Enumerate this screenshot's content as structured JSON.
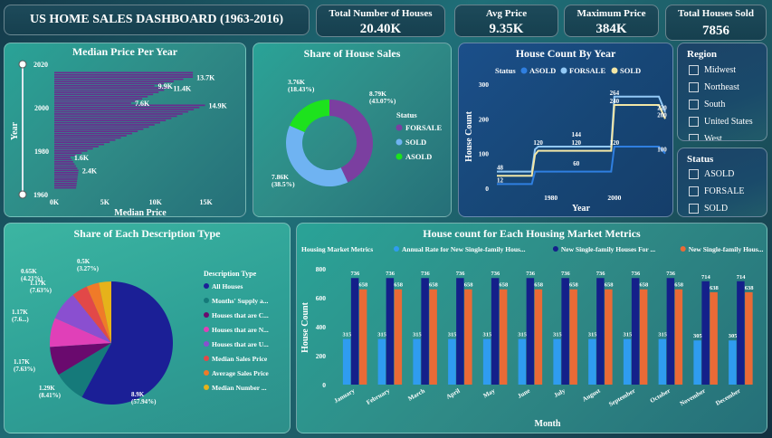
{
  "header": {
    "title": "US HOME SALES DASHBOARD (1963-2016)"
  },
  "kpis": [
    {
      "label": "Total Number of Houses",
      "value": "20.40K"
    },
    {
      "label": "Avg Price",
      "value": "9.35K"
    },
    {
      "label": "Maximum Price",
      "value": "384K"
    },
    {
      "label": "Total Houses Sold",
      "value": "7856"
    }
  ],
  "slicers": {
    "region": {
      "title": "Region",
      "options": [
        "Midwest",
        "Northeast",
        "South",
        "United States",
        "West"
      ]
    },
    "status": {
      "title": "Status",
      "options": [
        "ASOLD",
        "FORSALE",
        "SOLD"
      ]
    }
  },
  "colors": {
    "purple": "#7b3fa0",
    "lightblue": "#6fb3f2",
    "green": "#1de21d",
    "cream": "#f3e7a6",
    "sky": "#93c9f6",
    "blue": "#2f7fe0"
  },
  "chart_data": [
    {
      "id": "median",
      "type": "bar",
      "orientation": "horizontal",
      "title": "Median Price Per Year",
      "xlabel": "Median Price",
      "ylabel": "Year",
      "xticks": [
        "0K",
        "5K",
        "10K",
        "15K"
      ],
      "yticks": [
        "1960",
        "1980",
        "2000",
        "2020"
      ],
      "slider_labels": [
        "2020",
        "1960"
      ],
      "xlim": [
        0,
        17000
      ],
      "ylim": [
        1960,
        2020
      ],
      "years_range": [
        1963,
        2016
      ],
      "labeled_points": [
        {
          "year": 1971,
          "value": 2400,
          "label": "2.4K"
        },
        {
          "year": 1977,
          "value": 1600,
          "label": "1.6K"
        },
        {
          "year": 2002,
          "value": 7600,
          "label": "7.6K"
        },
        {
          "year": 2001,
          "value": 14900,
          "label": "14.9K"
        },
        {
          "year": 2009,
          "value": 11400,
          "label": "11.4K"
        },
        {
          "year": 2010,
          "value": 9900,
          "label": "9.9K"
        },
        {
          "year": 2014,
          "value": 13700,
          "label": "13.7K"
        }
      ]
    },
    {
      "id": "share_sales",
      "type": "pie",
      "title": "Share of House Sales",
      "legend_title": "Status",
      "slices": [
        {
          "name": "FORSALE",
          "value": 8790,
          "label": "8.79K (43.07%)",
          "color": "#7b3fa0"
        },
        {
          "name": "SOLD",
          "value": 7860,
          "label": "7.86K (38.5%)",
          "color": "#6fb3f2"
        },
        {
          "name": "ASOLD",
          "value": 3760,
          "label": "3.76K (18.43%)",
          "color": "#1de21d"
        }
      ]
    },
    {
      "id": "house_count",
      "type": "line",
      "title": "House Count By Year",
      "legend_title": "Status",
      "xlabel": "Year",
      "ylabel": "House Count",
      "xticks": [
        "1980",
        "2000"
      ],
      "yticks": [
        "0",
        "100",
        "200",
        "300"
      ],
      "ylim": [
        0,
        300
      ],
      "xlim": [
        1963,
        2016
      ],
      "series": [
        {
          "name": "ASOLD",
          "color": "#2f7fe0",
          "points": [
            [
              1963,
              12
            ],
            [
              1974,
              12
            ],
            [
              1975,
              48
            ],
            [
              1999,
              48
            ],
            [
              2000,
              120
            ],
            [
              2014,
              120
            ],
            [
              2016,
              100
            ]
          ]
        },
        {
          "name": "FORSALE",
          "color": "#93c9f6",
          "points": [
            [
              1963,
              48
            ],
            [
              1974,
              48
            ],
            [
              1975,
              112
            ],
            [
              1976,
              120
            ],
            [
              1999,
              120
            ],
            [
              2000,
              264
            ],
            [
              2014,
              264
            ],
            [
              2016,
              220
            ]
          ]
        },
        {
          "name": "SOLD",
          "color": "#f3e7a6",
          "points": [
            [
              1963,
              36
            ],
            [
              1974,
              36
            ],
            [
              1975,
              96
            ],
            [
              1976,
              108
            ],
            [
              1999,
              108
            ],
            [
              2000,
              240
            ],
            [
              2014,
              240
            ],
            [
              2016,
              200
            ]
          ]
        }
      ],
      "labels": [
        {
          "year": 1964,
          "value": 48,
          "text": "48"
        },
        {
          "year": 1964,
          "value": 12,
          "text": "12"
        },
        {
          "year": 1976,
          "value": 120,
          "text": "120"
        },
        {
          "year": 1988,
          "value": 144,
          "text": "144"
        },
        {
          "year": 1988,
          "value": 120,
          "text": "120"
        },
        {
          "year": 1988,
          "value": 60,
          "text": "60"
        },
        {
          "year": 2000,
          "value": 120,
          "text": "120"
        },
        {
          "year": 2000,
          "value": 264,
          "text": "264"
        },
        {
          "year": 2000,
          "value": 240,
          "text": "240"
        },
        {
          "year": 2015,
          "value": 220,
          "text": "220"
        },
        {
          "year": 2015,
          "value": 200,
          "text": "200"
        },
        {
          "year": 2015,
          "value": 100,
          "text": "100"
        }
      ]
    },
    {
      "id": "desc_share",
      "type": "pie",
      "title": "Share of Each Description Type",
      "legend_title": "Description Type",
      "slices": [
        {
          "name": "All Houses",
          "value": 57.94,
          "label": "8.9K (57.94%)",
          "color": "#1b1f96"
        },
        {
          "name": "Months' Supply a...",
          "value": 8.41,
          "label": "1.29K (8.41%)",
          "color": "#157a7a"
        },
        {
          "name": "Houses that are C...",
          "value": 7.63,
          "label": "1.17K (7.63%)",
          "color": "#6a0a6e"
        },
        {
          "name": "Houses that are N...",
          "value": 7.63,
          "label": "1.17K (7.6...)",
          "color": "#e040b8"
        },
        {
          "name": "Houses that are U...",
          "value": 7.63,
          "label": "1.17K (7.63%)",
          "color": "#8a4fd0"
        },
        {
          "name": "Median Sales Price",
          "value": 4.21,
          "label": "0.65K (4.21%)",
          "color": "#e24848"
        },
        {
          "name": "Average Sales Price",
          "value": 3.27,
          "label": "0.5K (3.27%)",
          "color": "#f07a28"
        },
        {
          "name": "Median Number ...",
          "value": 3.27,
          "label": "",
          "color": "#e6b21a"
        }
      ]
    },
    {
      "id": "metrics",
      "type": "bar",
      "title": "House count for Each Housing Market Metrics",
      "legend_title": "Housing Market Metrics",
      "xlabel": "Month",
      "ylabel": "House Count",
      "ylim": [
        0,
        800
      ],
      "yticks": [
        "0",
        "200",
        "400",
        "600",
        "800"
      ],
      "categories": [
        "January",
        "February",
        "March",
        "April",
        "May",
        "June",
        "July",
        "August",
        "September",
        "October",
        "November",
        "December"
      ],
      "series": [
        {
          "name": "Annual Rate for New Single-family Hous...",
          "color": "#2f9cf0",
          "values": [
            315,
            315,
            315,
            315,
            315,
            315,
            315,
            315,
            315,
            315,
            305,
            305
          ]
        },
        {
          "name": "New Single-family Houses For ...",
          "color": "#14208a",
          "values": [
            736,
            736,
            736,
            736,
            736,
            736,
            736,
            736,
            736,
            736,
            714,
            714
          ]
        },
        {
          "name": "New Single-family Hous...",
          "color": "#ea6a36",
          "values": [
            658,
            658,
            658,
            658,
            658,
            658,
            658,
            658,
            658,
            658,
            638,
            638
          ]
        }
      ]
    }
  ]
}
